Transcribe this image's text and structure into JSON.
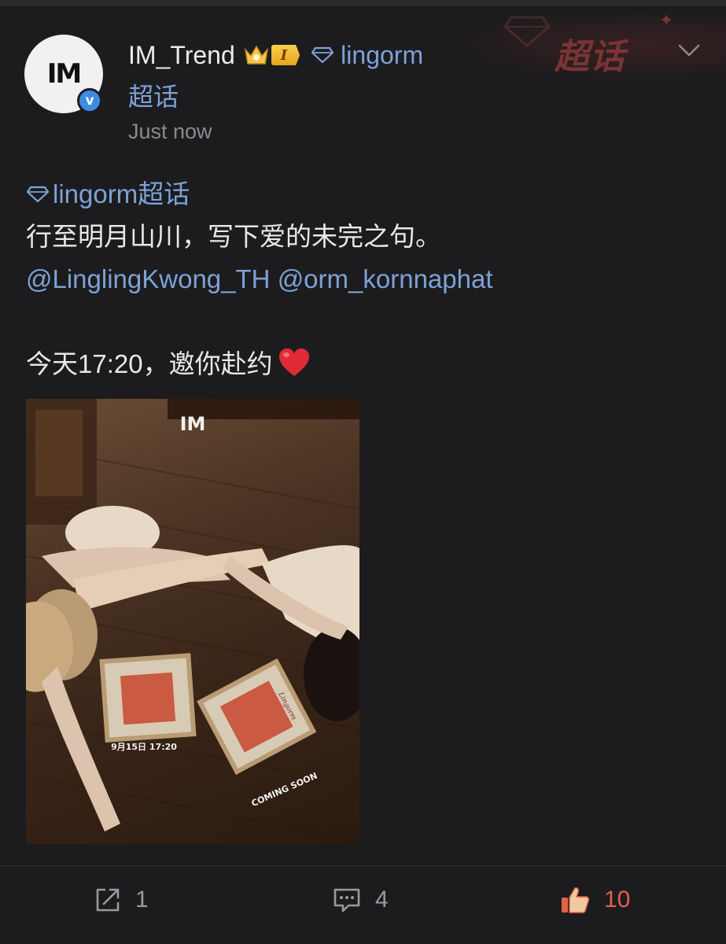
{
  "header": {
    "avatar_text": "IM",
    "verified_mark": "v",
    "username": "IM_Trend",
    "level": "I",
    "topic_name": "lingorm",
    "topic_suffix": "超话",
    "timestamp": "Just now",
    "banner_label": "超话",
    "banner_sparkle": "✦"
  },
  "post": {
    "topic_tag": "lingorm超话",
    "line1": "行至明月山川，写下爱的未完之句。",
    "mentions": [
      "@LinglingKwong_TH",
      "@orm_kornnaphat"
    ],
    "line3": "今天17:20，邀你赴约"
  },
  "image": {
    "watermark": "IM",
    "frame1_text": "9月15日 17:20",
    "frame2_text": "COMING SOON",
    "box_title": "Lingorm"
  },
  "actions": {
    "share_count": "1",
    "comment_count": "4",
    "like_count": "10"
  },
  "colors": {
    "background": "#1c1c1e",
    "link": "#7da2d6",
    "like_active": "#e0634a",
    "verified": "#3d8ce4"
  },
  "icons": [
    "crown-icon",
    "diamond-icon",
    "chevron-down-icon",
    "heart-icon",
    "share-icon",
    "comment-icon",
    "thumbs-up-icon"
  ]
}
